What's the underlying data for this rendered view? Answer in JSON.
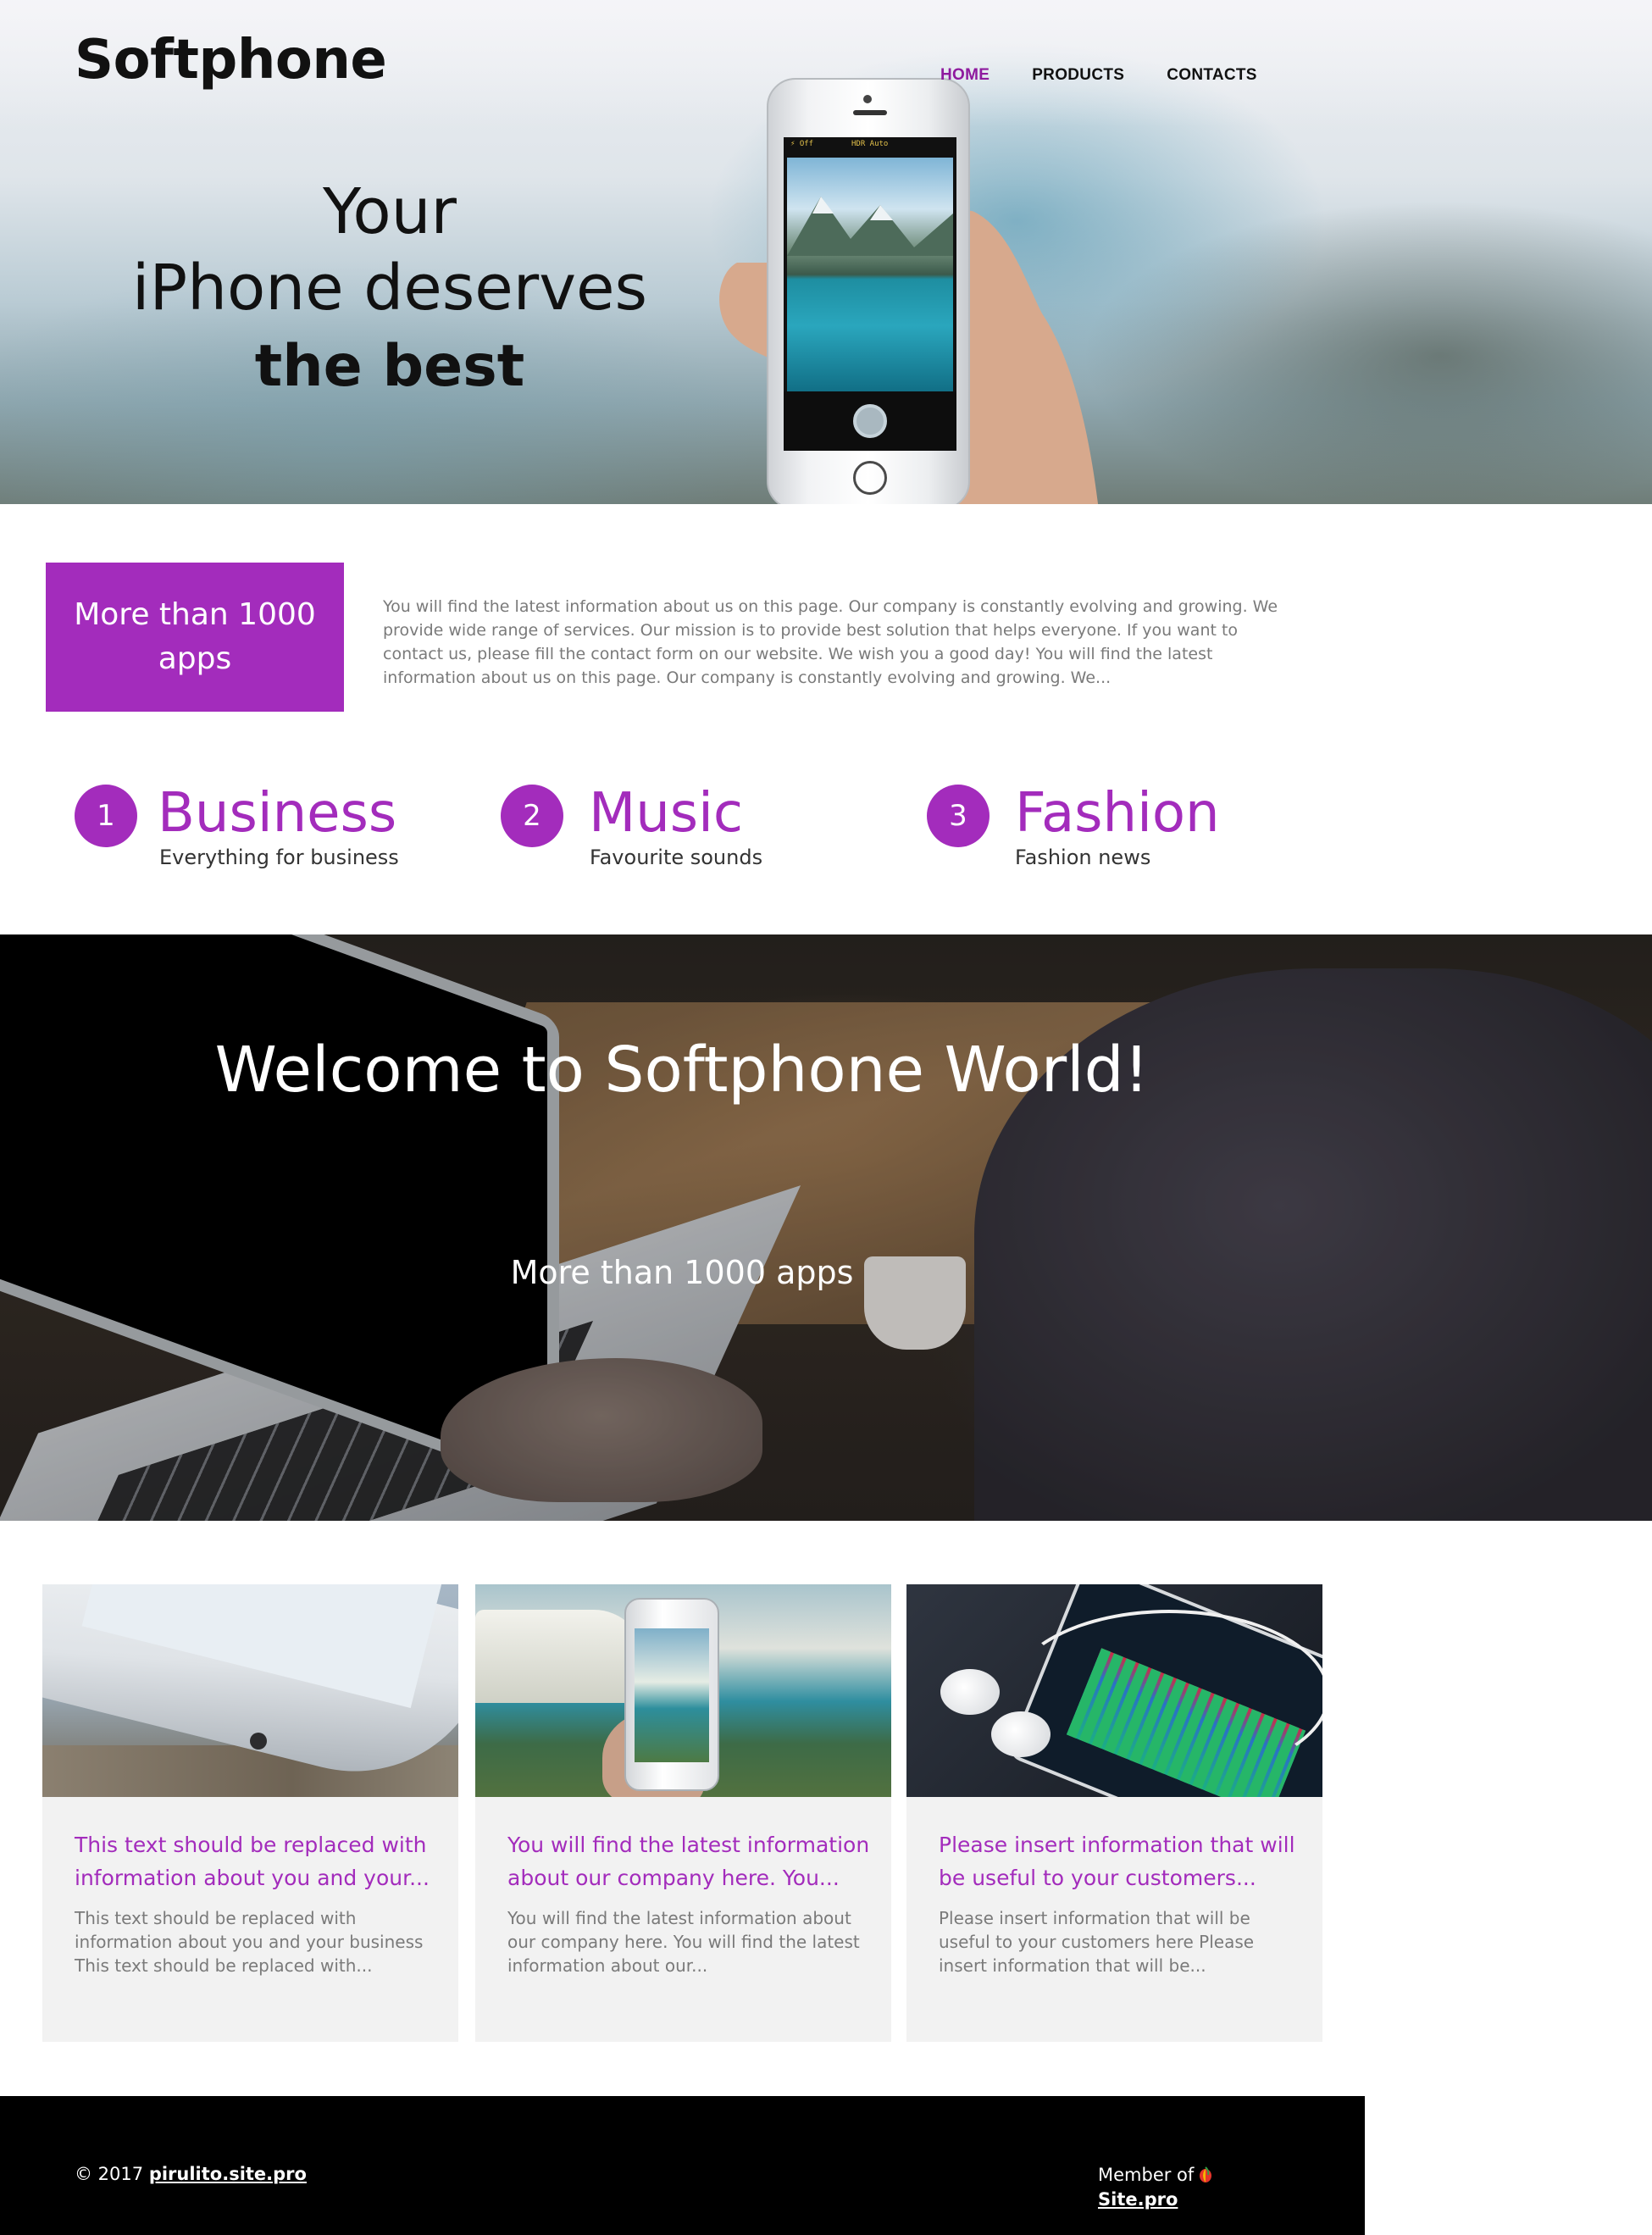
{
  "header": {
    "logo": "Softphone",
    "nav": [
      {
        "label": "HOME",
        "active": true
      },
      {
        "label": "PRODUCTS",
        "active": false
      },
      {
        "label": "CONTACTS",
        "active": false
      }
    ]
  },
  "hero": {
    "line1": "Your",
    "line2": "iPhone deserves",
    "line3": "the best",
    "camera_topbar_left": "⚡ Off",
    "camera_topbar_center": "HDR Auto"
  },
  "intro": {
    "promo": "More than 1000 apps",
    "text": "You will find the latest information about us on this page. Our company is constantly evolving and growing. We provide wide range of services. Our mission is to provide best solution that helps everyone. If you want to contact us, please fill the contact form on our website. We wish you a good day! You will find the latest information about us on this page. Our company is constantly evolving and growing. We..."
  },
  "features": [
    {
      "number": "1",
      "title": "Business",
      "subtitle": "Everything for business"
    },
    {
      "number": "2",
      "title": "Music",
      "subtitle": "Favourite sounds"
    },
    {
      "number": "3",
      "title": "Fashion",
      "subtitle": "Fashion news"
    }
  ],
  "banner": {
    "title": "Welcome to Softphone World!",
    "subtitle": "More than 1000 apps"
  },
  "cards": [
    {
      "title": "This text should be replaced with information about you and your...",
      "text": "This text should be replaced with information about you and your business This text should be replaced with..."
    },
    {
      "title": "You will find the latest information about our company here. You...",
      "text": "You will find the latest information about our company here. You will find the latest information about our..."
    },
    {
      "title": "Please insert information that will be useful to your customers...",
      "text": "Please insert information that will be useful to your customers here Please insert information that will be..."
    }
  ],
  "footer": {
    "copyright_prefix": "© 2017",
    "site_link": "pirulito.site.pro",
    "member_of": "Member of",
    "member_link": "Site.pro"
  },
  "colors": {
    "accent": "#a32cbc",
    "nav_active": "#8e1a9e",
    "footer_bg": "#000000",
    "card_bg": "#f2f2f2"
  },
  "icons": [
    "site-pro-logo-icon"
  ]
}
